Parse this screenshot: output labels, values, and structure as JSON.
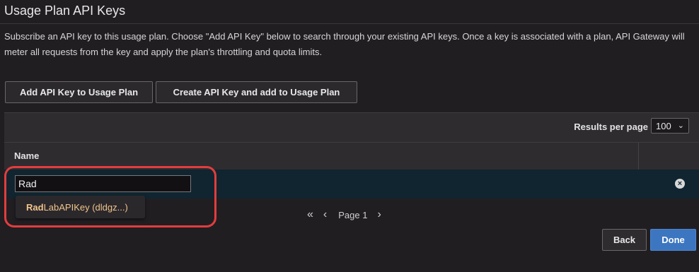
{
  "header": {
    "title": "Usage Plan API Keys"
  },
  "description": "Subscribe an API key to this usage plan. Choose \"Add API Key\" below to search through your existing API keys. Once a key is associated with a plan, API Gateway will meter all requests from the key and apply the plan's throttling and quota limits.",
  "actions": {
    "add_key_label": "Add API Key to Usage Plan",
    "create_key_label": "Create API Key and add to Usage Plan"
  },
  "table": {
    "results_per_page_label": "Results per page",
    "results_per_page_value": "100",
    "column_name": "Name",
    "search_value": "Rad",
    "suggestion": {
      "match": "Rad",
      "rest": "LabAPIKey (dldgz...)"
    }
  },
  "pagination": {
    "page_label": "Page 1"
  },
  "footer": {
    "back_label": "Back",
    "done_label": "Done"
  },
  "colors": {
    "accent": "#3d76c0",
    "highlight": "#e23d3d"
  }
}
